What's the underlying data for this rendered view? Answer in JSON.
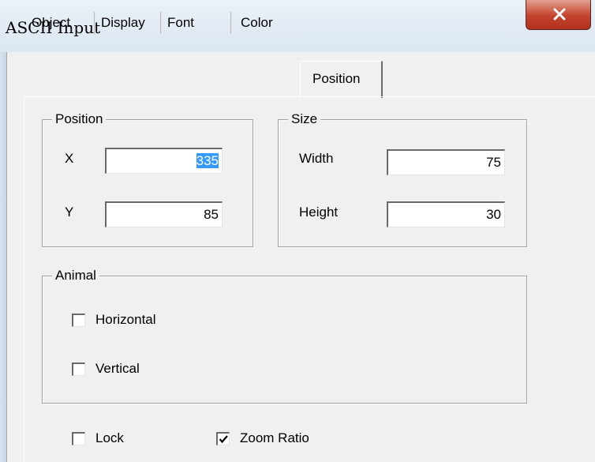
{
  "window": {
    "title": "ASCII Input"
  },
  "tabs": [
    {
      "label": "Object"
    },
    {
      "label": "Display"
    },
    {
      "label": "Font"
    },
    {
      "label": "Color"
    },
    {
      "label": "Position",
      "active": true
    }
  ],
  "position_group": {
    "title": "Position",
    "x_label": "X",
    "x_value": "335",
    "y_label": "Y",
    "y_value": "85"
  },
  "size_group": {
    "title": "Size",
    "width_label": "Width",
    "width_value": "75",
    "height_label": "Height",
    "height_value": "30"
  },
  "animal_group": {
    "title": "Animal",
    "horizontal": {
      "label": "Horizontal",
      "checked": false
    },
    "vertical": {
      "label": "Vertical",
      "checked": false
    }
  },
  "footer": {
    "lock": {
      "label": "Lock",
      "checked": false
    },
    "zoom_ratio": {
      "label": "Zoom Ratio",
      "checked": true
    }
  }
}
